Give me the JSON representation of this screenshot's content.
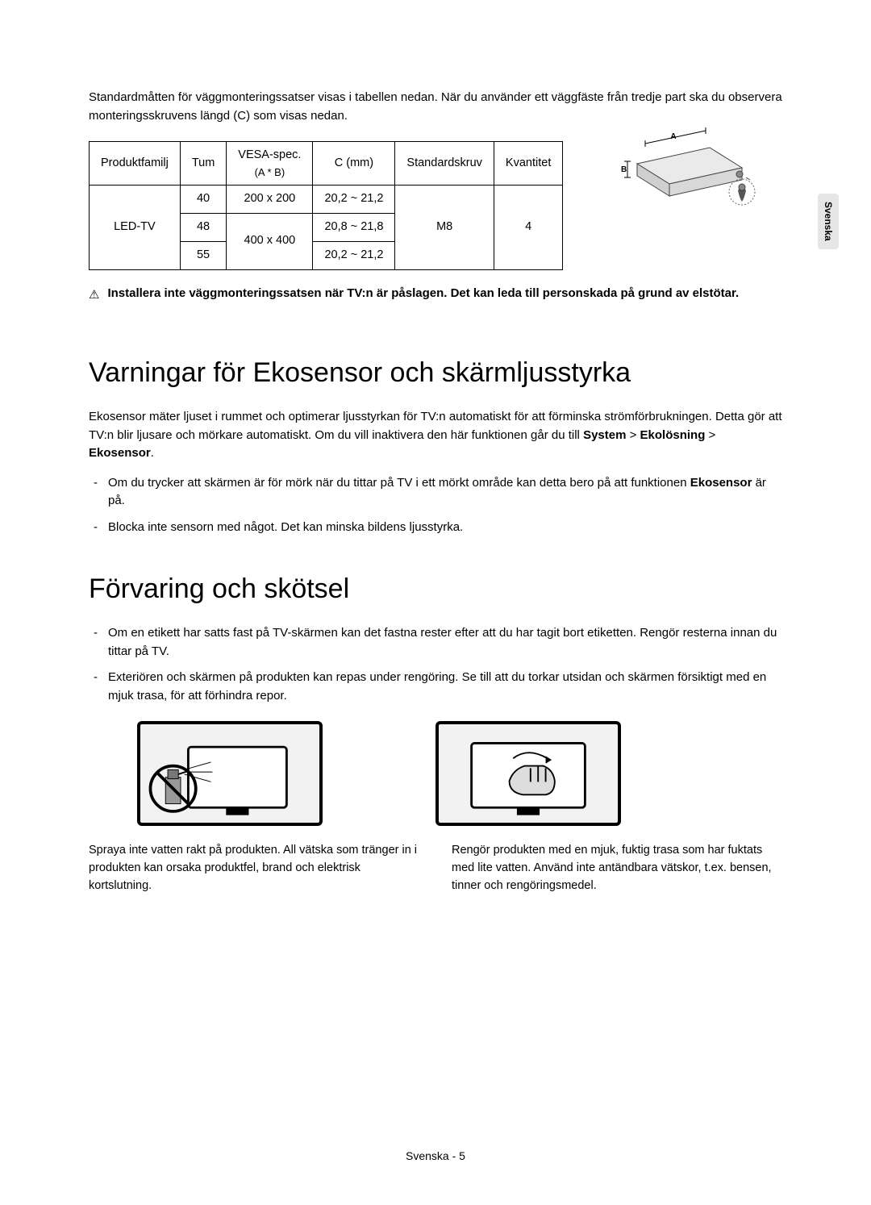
{
  "side_tab": "Svenska",
  "intro": "Standardmåtten för väggmonteringssatser visas i tabellen nedan. När du använder ett väggfäste från tredje part ska du observera monteringsskruvens längd (C) som visas nedan.",
  "table": {
    "headers": {
      "family": "Produktfamilj",
      "inches": "Tum",
      "vesa_top": "VESA-spec.",
      "vesa_sub": "(A * B)",
      "c": "C (mm)",
      "screw": "Standardskruv",
      "qty": "Kvantitet"
    },
    "family_value": "LED-TV",
    "screw_value": "M8",
    "qty_value": "4",
    "rows": [
      {
        "inches": "40",
        "vesa": "200 x 200",
        "c": "20,2 ~ 21,2"
      },
      {
        "inches": "48",
        "vesa": "400 x 400",
        "c": "20,8 ~ 21,8"
      },
      {
        "inches": "55",
        "vesa": "",
        "c": "20,2 ~ 21,2"
      }
    ]
  },
  "diagram_labels": {
    "A": "A",
    "B": "B"
  },
  "warning": "Installera inte väggmonteringssatsen när TV:n är påslagen. Det kan leda till personskada på grund av elstötar.",
  "eco": {
    "heading": "Varningar för Ekosensor och skärmljusstyrka",
    "para_pre": "Ekosensor mäter ljuset i rummet och optimerar ljusstyrkan för TV:n automatiskt för att förminska strömförbrukningen. Detta gör att TV:n blir ljusare och mörkare automatiskt. Om du vill inaktivera den här funktionen går du till ",
    "sys": "System",
    "gt1": " > ",
    "ekol": "Ekolösning",
    "gt2": " > ",
    "ekos": "Ekosensor",
    "period": ".",
    "bullets": [
      {
        "pre": "Om du trycker att skärmen är för mörk när du tittar på TV i ett mörkt område kan detta bero på att funktionen ",
        "bold": "Ekosensor",
        "post": " är på."
      },
      {
        "pre": "Blocka inte sensorn med något. Det kan minska bildens ljusstyrka.",
        "bold": "",
        "post": ""
      }
    ]
  },
  "storage": {
    "heading": "Förvaring och skötsel",
    "bullets": [
      "Om en etikett har satts fast på TV-skärmen kan det fastna rester efter att du har tagit bort etiketten. Rengör resterna innan du tittar på TV.",
      "Exteriören och skärmen på produkten kan repas under rengöring. Se till att du torkar utsidan och skärmen försiktigt med en mjuk trasa, för att förhindra repor."
    ],
    "captions": [
      "Spraya inte vatten rakt på produkten. All vätska som tränger in i produkten kan orsaka produktfel, brand och elektrisk kortslutning.",
      "Rengör produkten med en mjuk, fuktig trasa som har fuktats med lite vatten. Använd inte antändbara vätskor, t.ex. bensen, tinner och rengöringsmedel."
    ]
  },
  "footer": {
    "lang": "Svenska",
    "sep": " - ",
    "page": "5"
  }
}
